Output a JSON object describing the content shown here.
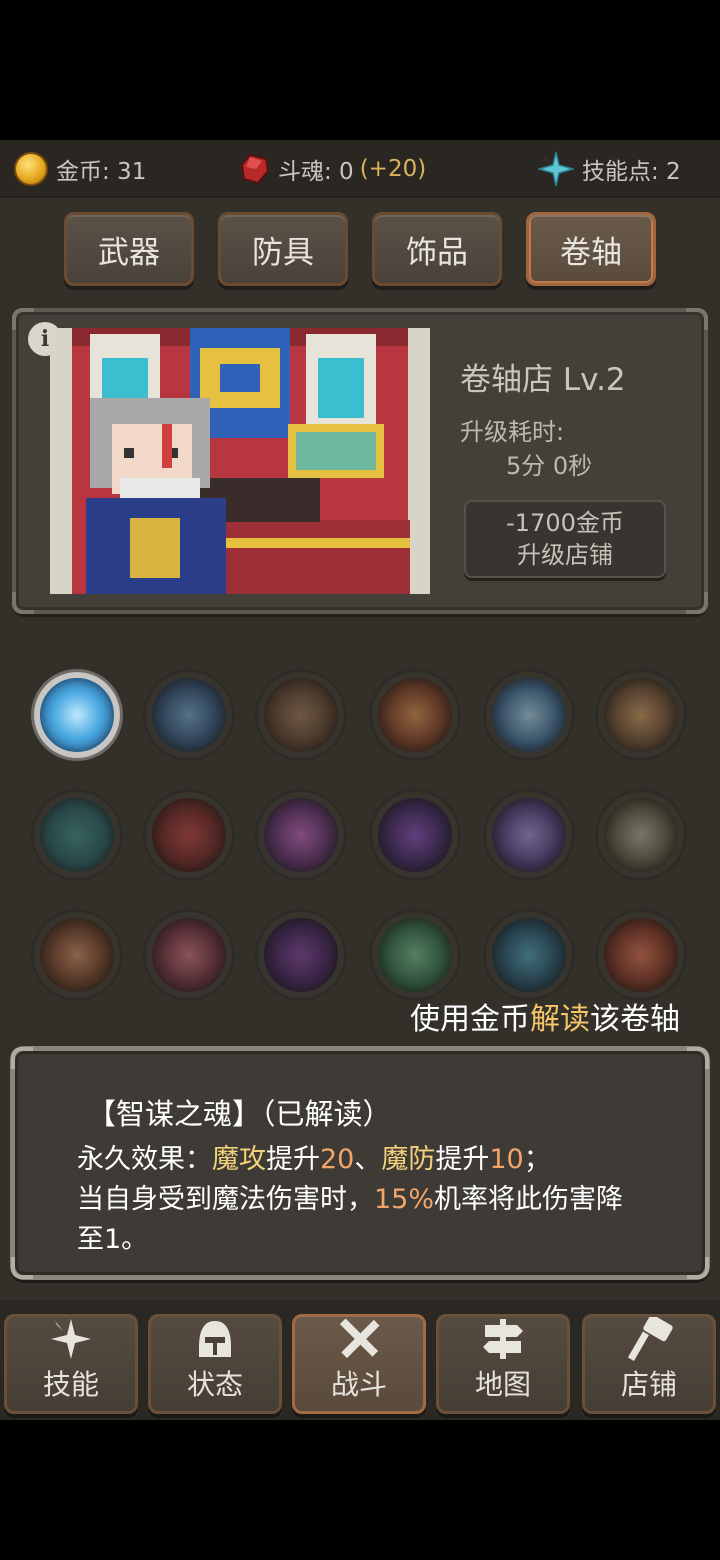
{
  "resources": {
    "gold_label": "金币: 31",
    "soul_label": "斗魂: 0",
    "soul_bonus": "(+20)",
    "skill_label": "技能点: 2"
  },
  "tabs": [
    {
      "label": "武器"
    },
    {
      "label": "防具"
    },
    {
      "label": "饰品"
    },
    {
      "label": "卷轴"
    }
  ],
  "active_tab": "卷轴",
  "shop": {
    "info_icon": "i",
    "name": "卷轴店 Lv.2",
    "upgrade_time_label": "升级耗时:",
    "upgrade_time": "5分 0秒",
    "upgrade_cost": "-1700金币",
    "upgrade_action": "升级店铺"
  },
  "scrolls": {
    "selected_index": 0,
    "icons": [
      "ice-shield-scroll-icon",
      "lightning-claw-scroll-icon",
      "target-scroll-icon",
      "fire-burst-scroll-icon",
      "frost-tree-scroll-icon",
      "dragon-scroll-icon",
      "vortex-scroll-icon",
      "red-slash-scroll-icon",
      "purple-beast-scroll-icon",
      "demon-mask-scroll-icon",
      "shatter-scroll-icon",
      "armor-scroll-icon",
      "fist-scroll-icon",
      "wind-spiral-scroll-icon",
      "net-scroll-icon",
      "heart-heal-scroll-icon",
      "water-sigil-scroll-icon",
      "flame-orb-scroll-icon"
    ]
  },
  "hint": {
    "prefix": "使用金币",
    "highlight": "解读",
    "suffix": "该卷轴"
  },
  "description": {
    "title": "【智谋之魂】（已解读）",
    "line1_prefix": "永久效果：",
    "line1_attr1": "魔攻",
    "line1_mid1": "提升",
    "line1_val1": "20",
    "line1_sep": "、",
    "line1_attr2": "魔防",
    "line1_mid2": "提升",
    "line1_val2": "10",
    "line1_end": "；",
    "line2_prefix": "当自身受到魔法伤害时，",
    "line2_pct": "15%",
    "line2_suffix": "机率将此伤害降",
    "line3": "至1。"
  },
  "nav": [
    {
      "label": "技能",
      "icon": "sparkle-icon"
    },
    {
      "label": "状态",
      "icon": "helmet-icon"
    },
    {
      "label": "战斗",
      "icon": "crossed-swords-icon"
    },
    {
      "label": "地图",
      "icon": "signpost-icon"
    },
    {
      "label": "店铺",
      "icon": "hammer-icon"
    }
  ],
  "active_nav": "战斗",
  "colors": {
    "highlight_yellow": "#f2d27a",
    "highlight_orange": "#f3a56a",
    "hint_highlight": "#f5c56a",
    "soul_bonus": "#d8b35c"
  }
}
